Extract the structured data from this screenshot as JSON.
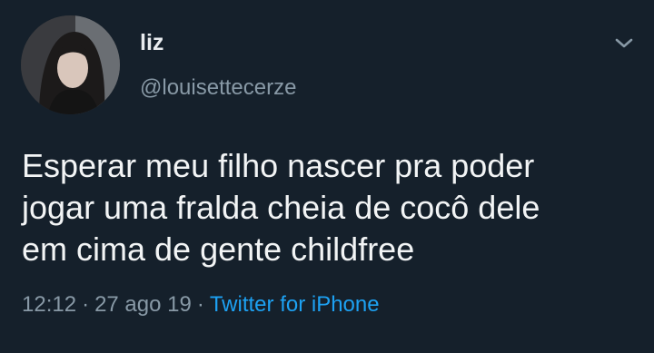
{
  "tweet": {
    "display_name": "liz",
    "handle": "@louisettecerze",
    "text_lines": [
      "Esperar meu filho nascer pra poder",
      "jogar uma fralda cheia de cocô dele",
      "em cima de gente childfree"
    ],
    "time": "12:12",
    "date": "27 ago 19",
    "separator": "·",
    "source": "Twitter for iPhone"
  },
  "icons": {
    "menu": "chevron-down-icon"
  },
  "colors": {
    "background": "#15202b",
    "primary_text": "#f2f4f5",
    "secondary_text": "#8899a6",
    "accent": "#1da1f2"
  }
}
